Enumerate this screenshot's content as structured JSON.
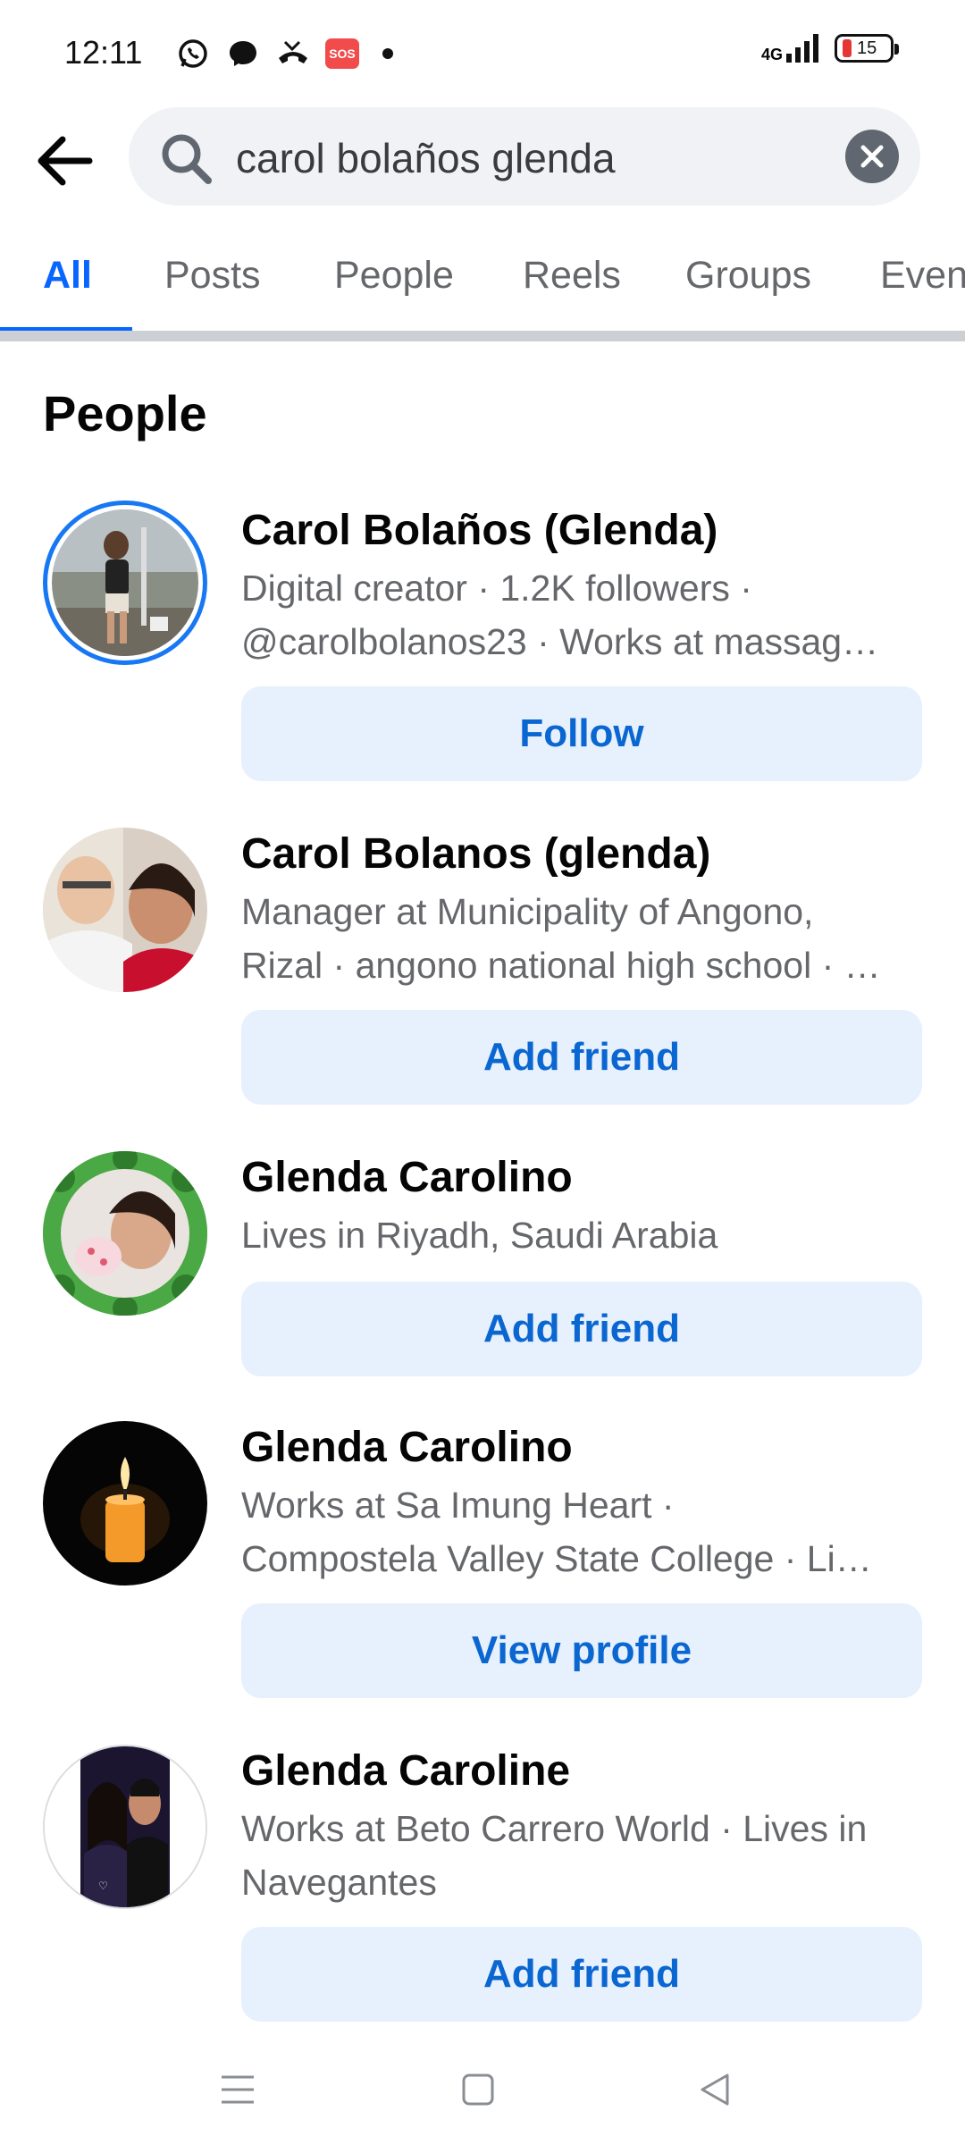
{
  "status_bar": {
    "time": "12:11",
    "sos_label": "SOS",
    "network_label": "4G",
    "battery_percent": "15"
  },
  "search": {
    "query": "carol bolaños glenda"
  },
  "tabs": [
    {
      "label": "All",
      "active": true
    },
    {
      "label": "Posts",
      "active": false
    },
    {
      "label": "People",
      "active": false
    },
    {
      "label": "Reels",
      "active": false
    },
    {
      "label": "Groups",
      "active": false
    },
    {
      "label": "Even",
      "active": false
    }
  ],
  "section": {
    "title": "People"
  },
  "results": [
    {
      "name": "Carol Bolaños (Glenda)",
      "desc_lines": [
        "Digital creator · 1.2K followers ·",
        "@carolbolanos23 · Works at massag…"
      ],
      "action": "Follow"
    },
    {
      "name": "Carol Bolanos (glenda)",
      "desc_lines": [
        "Manager at Municipality of Angono,",
        "Rizal · angono national high school · …"
      ],
      "action": "Add friend"
    },
    {
      "name": "Glenda Carolino",
      "desc_lines": [
        "Lives in Riyadh, Saudi Arabia"
      ],
      "action": "Add friend"
    },
    {
      "name": "Glenda Carolino",
      "desc_lines": [
        "Works at Sa Imung Heart ·",
        "Compostela Valley State College · Li…"
      ],
      "action": "View profile"
    },
    {
      "name": "Glenda Caroline",
      "desc_lines": [
        "Works at Beto Carrero World · Lives in",
        "Navegantes"
      ],
      "action": "Add friend"
    }
  ],
  "colors": {
    "accent": "#0866ff",
    "button_bg": "#e7f0fd",
    "button_text": "#0a66d0",
    "secondary_text": "#65676b"
  },
  "icons": {
    "back": "arrow-left-icon",
    "search": "search-icon",
    "clear": "close-icon",
    "nav_menu": "menu-icon",
    "nav_home": "square-icon",
    "nav_back": "triangle-back-icon"
  }
}
